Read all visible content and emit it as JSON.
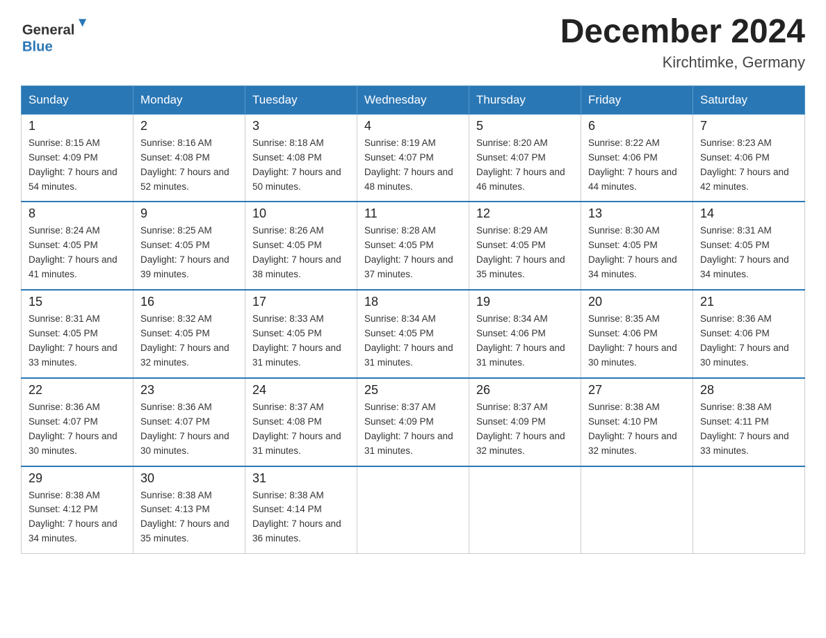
{
  "logo": {
    "general": "General",
    "blue": "Blue"
  },
  "header": {
    "month": "December 2024",
    "location": "Kirchtimke, Germany"
  },
  "weekdays": [
    "Sunday",
    "Monday",
    "Tuesday",
    "Wednesday",
    "Thursday",
    "Friday",
    "Saturday"
  ],
  "weeks": [
    [
      {
        "day": "1",
        "sunrise": "8:15 AM",
        "sunset": "4:09 PM",
        "daylight": "7 hours and 54 minutes."
      },
      {
        "day": "2",
        "sunrise": "8:16 AM",
        "sunset": "4:08 PM",
        "daylight": "7 hours and 52 minutes."
      },
      {
        "day": "3",
        "sunrise": "8:18 AM",
        "sunset": "4:08 PM",
        "daylight": "7 hours and 50 minutes."
      },
      {
        "day": "4",
        "sunrise": "8:19 AM",
        "sunset": "4:07 PM",
        "daylight": "7 hours and 48 minutes."
      },
      {
        "day": "5",
        "sunrise": "8:20 AM",
        "sunset": "4:07 PM",
        "daylight": "7 hours and 46 minutes."
      },
      {
        "day": "6",
        "sunrise": "8:22 AM",
        "sunset": "4:06 PM",
        "daylight": "7 hours and 44 minutes."
      },
      {
        "day": "7",
        "sunrise": "8:23 AM",
        "sunset": "4:06 PM",
        "daylight": "7 hours and 42 minutes."
      }
    ],
    [
      {
        "day": "8",
        "sunrise": "8:24 AM",
        "sunset": "4:05 PM",
        "daylight": "7 hours and 41 minutes."
      },
      {
        "day": "9",
        "sunrise": "8:25 AM",
        "sunset": "4:05 PM",
        "daylight": "7 hours and 39 minutes."
      },
      {
        "day": "10",
        "sunrise": "8:26 AM",
        "sunset": "4:05 PM",
        "daylight": "7 hours and 38 minutes."
      },
      {
        "day": "11",
        "sunrise": "8:28 AM",
        "sunset": "4:05 PM",
        "daylight": "7 hours and 37 minutes."
      },
      {
        "day": "12",
        "sunrise": "8:29 AM",
        "sunset": "4:05 PM",
        "daylight": "7 hours and 35 minutes."
      },
      {
        "day": "13",
        "sunrise": "8:30 AM",
        "sunset": "4:05 PM",
        "daylight": "7 hours and 34 minutes."
      },
      {
        "day": "14",
        "sunrise": "8:31 AM",
        "sunset": "4:05 PM",
        "daylight": "7 hours and 34 minutes."
      }
    ],
    [
      {
        "day": "15",
        "sunrise": "8:31 AM",
        "sunset": "4:05 PM",
        "daylight": "7 hours and 33 minutes."
      },
      {
        "day": "16",
        "sunrise": "8:32 AM",
        "sunset": "4:05 PM",
        "daylight": "7 hours and 32 minutes."
      },
      {
        "day": "17",
        "sunrise": "8:33 AM",
        "sunset": "4:05 PM",
        "daylight": "7 hours and 31 minutes."
      },
      {
        "day": "18",
        "sunrise": "8:34 AM",
        "sunset": "4:05 PM",
        "daylight": "7 hours and 31 minutes."
      },
      {
        "day": "19",
        "sunrise": "8:34 AM",
        "sunset": "4:06 PM",
        "daylight": "7 hours and 31 minutes."
      },
      {
        "day": "20",
        "sunrise": "8:35 AM",
        "sunset": "4:06 PM",
        "daylight": "7 hours and 30 minutes."
      },
      {
        "day": "21",
        "sunrise": "8:36 AM",
        "sunset": "4:06 PM",
        "daylight": "7 hours and 30 minutes."
      }
    ],
    [
      {
        "day": "22",
        "sunrise": "8:36 AM",
        "sunset": "4:07 PM",
        "daylight": "7 hours and 30 minutes."
      },
      {
        "day": "23",
        "sunrise": "8:36 AM",
        "sunset": "4:07 PM",
        "daylight": "7 hours and 30 minutes."
      },
      {
        "day": "24",
        "sunrise": "8:37 AM",
        "sunset": "4:08 PM",
        "daylight": "7 hours and 31 minutes."
      },
      {
        "day": "25",
        "sunrise": "8:37 AM",
        "sunset": "4:09 PM",
        "daylight": "7 hours and 31 minutes."
      },
      {
        "day": "26",
        "sunrise": "8:37 AM",
        "sunset": "4:09 PM",
        "daylight": "7 hours and 32 minutes."
      },
      {
        "day": "27",
        "sunrise": "8:38 AM",
        "sunset": "4:10 PM",
        "daylight": "7 hours and 32 minutes."
      },
      {
        "day": "28",
        "sunrise": "8:38 AM",
        "sunset": "4:11 PM",
        "daylight": "7 hours and 33 minutes."
      }
    ],
    [
      {
        "day": "29",
        "sunrise": "8:38 AM",
        "sunset": "4:12 PM",
        "daylight": "7 hours and 34 minutes."
      },
      {
        "day": "30",
        "sunrise": "8:38 AM",
        "sunset": "4:13 PM",
        "daylight": "7 hours and 35 minutes."
      },
      {
        "day": "31",
        "sunrise": "8:38 AM",
        "sunset": "4:14 PM",
        "daylight": "7 hours and 36 minutes."
      },
      null,
      null,
      null,
      null
    ]
  ]
}
